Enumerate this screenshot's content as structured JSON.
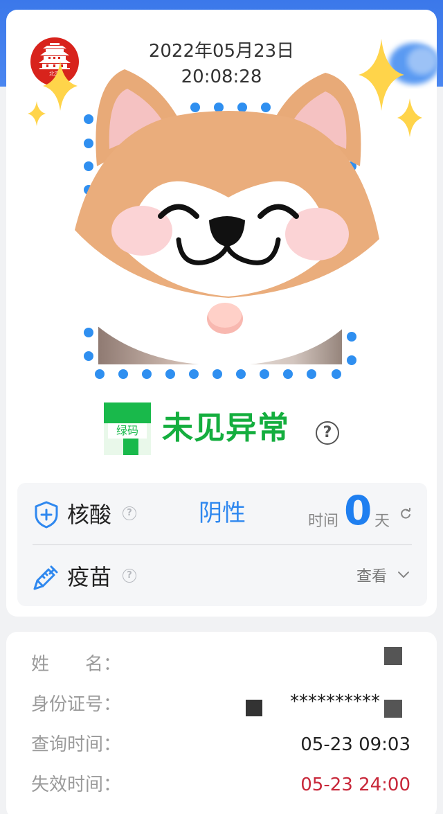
{
  "header": {
    "logo_caption": "北京",
    "date": "2022年05月23日",
    "time": "20:08:28"
  },
  "status": {
    "badge_label": "绿码",
    "text": "未见异常",
    "help_glyph": "?"
  },
  "nucleic": {
    "label": "核酸",
    "help_glyph": "?",
    "result": "阴性",
    "time_label": "时间",
    "days": "0",
    "days_unit": "天",
    "icon": "shield-plus-icon"
  },
  "vaccine": {
    "label": "疫苗",
    "help_glyph": "?",
    "view_label": "查看",
    "icon": "syringe-icon"
  },
  "info": {
    "name_label": "姓　　名：",
    "id_label": "身份证号：",
    "id_value": "**********",
    "query_label": "查询时间：",
    "query_value": "05-23 09:03",
    "expiry_label": "失效时间：",
    "expiry_value": "05-23 24:00"
  },
  "colors": {
    "header_blue": "#3b78ea",
    "green": "#14ae3e",
    "accent_blue": "#2f88ef",
    "expiry_red": "#c8283a"
  }
}
